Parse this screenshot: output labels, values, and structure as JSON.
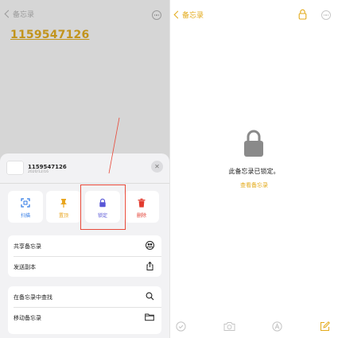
{
  "left": {
    "nav": {
      "back_label": "备忘录"
    },
    "note_title": "1159547126",
    "sheet": {
      "note_title": "1159547126",
      "note_date": "2020/12/16",
      "actions": [
        {
          "label": "扫描",
          "icon": "scan-icon"
        },
        {
          "label": "置顶",
          "icon": "pin-icon"
        },
        {
          "label": "锁定",
          "icon": "lock-icon"
        },
        {
          "label": "删除",
          "icon": "trash-icon"
        }
      ],
      "group1": [
        {
          "label": "共享备忘录",
          "icon": "share-people-icon"
        },
        {
          "label": "发送副本",
          "icon": "share-upload-icon"
        }
      ],
      "group2": [
        {
          "label": "在备忘录中查找",
          "icon": "search-icon"
        },
        {
          "label": "移动备忘录",
          "icon": "folder-icon"
        }
      ]
    },
    "colors": {
      "accent": "#c2941c",
      "annotation": "#e84a3a",
      "lock": "#5856d6",
      "delete": "#e23b2f",
      "scan": "#2f7ae5",
      "pin": "#e8a51e"
    }
  },
  "right": {
    "nav": {
      "back_label": "备忘录"
    },
    "locked_message": "此备忘录已锁定。",
    "view_note_label": "查看备忘录",
    "bottom_icons": [
      "checklist-icon",
      "camera-icon",
      "markup-icon",
      "compose-icon"
    ],
    "colors": {
      "accent": "#e3aa1a"
    }
  }
}
